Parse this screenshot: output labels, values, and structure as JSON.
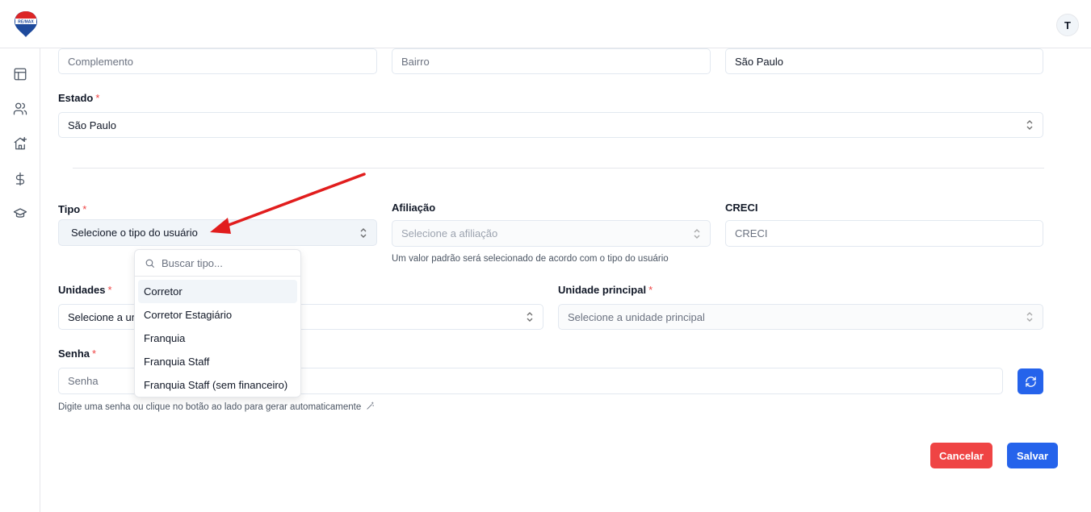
{
  "header": {
    "logo_text": "RE/MAX",
    "avatar_initial": "T"
  },
  "sidebar": {
    "items": [
      {
        "icon": "layout-icon"
      },
      {
        "icon": "users-icon"
      },
      {
        "icon": "house-plus-icon"
      },
      {
        "icon": "dollar-icon"
      },
      {
        "icon": "graduation-cap-icon"
      }
    ]
  },
  "form": {
    "complemento": {
      "placeholder": "Complemento"
    },
    "bairro": {
      "placeholder": "Bairro"
    },
    "cidade": {
      "value": "São Paulo"
    },
    "estado": {
      "label": "Estado",
      "required": "*",
      "value": "São Paulo"
    },
    "tipo": {
      "label": "Tipo",
      "required": "*",
      "value": "Selecione o tipo do usuário"
    },
    "afiliacao": {
      "label": "Afiliação",
      "placeholder": "Selecione a afiliação",
      "hint": "Um valor padrão será selecionado de acordo com o tipo do usuário"
    },
    "creci": {
      "label": "CRECI",
      "placeholder": "CRECI"
    },
    "unidades": {
      "label": "Unidades",
      "required": "*",
      "placeholder": "Selecione a uni"
    },
    "unidade_principal": {
      "label": "Unidade principal",
      "required": "*",
      "placeholder": "Selecione a unidade principal"
    },
    "senha": {
      "label": "Senha",
      "required": "*",
      "placeholder": "Senha",
      "hint": "Digite uma senha ou clique no botão ao lado para gerar automaticamente"
    }
  },
  "dropdown": {
    "search_placeholder": "Buscar tipo...",
    "options": [
      "Corretor",
      "Corretor Estagiário",
      "Franquia",
      "Franquia Staff",
      "Franquia Staff (sem financeiro)"
    ],
    "highlighted_index": 0
  },
  "actions": {
    "cancel_label": "Cancelar",
    "save_label": "Salvar"
  },
  "colors": {
    "primary": "#2563eb",
    "danger": "#ef4444",
    "annotation_arrow": "#e11d1d"
  }
}
